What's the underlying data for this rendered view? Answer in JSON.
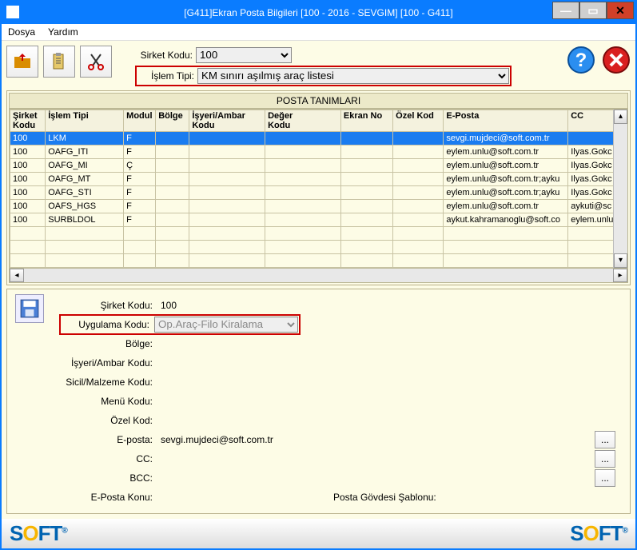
{
  "window": {
    "title": "[G411]Ekran Posta Bilgileri [100 - 2016 - SEVGIM] [100 - G411]"
  },
  "menu": {
    "file": "Dosya",
    "help": "Yardım"
  },
  "filters": {
    "sirket_label": "Sirket Kodu:",
    "sirket_value": "100",
    "islem_label": "İşlem Tipi:",
    "islem_value": "KM sınırı aşılmış araç listesi"
  },
  "grid": {
    "title": "POSTA TANIMLARI",
    "cols": [
      "Şirket Kodu",
      "İşlem Tipi",
      "Modul",
      "Bölge",
      "İşyeri/Ambar Kodu",
      "Değer Kodu",
      "Ekran No",
      "Özel Kod",
      "E-Posta",
      "CC"
    ],
    "rows": [
      {
        "sel": true,
        "c": [
          "100",
          "LKM",
          "F",
          "",
          "",
          "",
          "",
          "",
          "sevgi.mujdeci@soft.com.tr",
          ""
        ]
      },
      {
        "sel": false,
        "c": [
          "100",
          "OAFG_ITI",
          "F",
          "",
          "",
          "",
          "",
          "",
          "eylem.unlu@soft.com.tr",
          "Ilyas.Gokc"
        ]
      },
      {
        "sel": false,
        "c": [
          "100",
          "OAFG_MI",
          "Ç",
          "",
          "",
          "",
          "",
          "",
          "eylem.unlu@soft.com.tr",
          "Ilyas.Gokc"
        ]
      },
      {
        "sel": false,
        "c": [
          "100",
          "OAFG_MT",
          "F",
          "",
          "",
          "",
          "",
          "",
          "eylem.unlu@soft.com.tr;ayku",
          "Ilyas.Gokc"
        ]
      },
      {
        "sel": false,
        "c": [
          "100",
          "OAFG_STI",
          "F",
          "",
          "",
          "",
          "",
          "",
          "eylem.unlu@soft.com.tr;ayku",
          "Ilyas.Gokc"
        ]
      },
      {
        "sel": false,
        "c": [
          "100",
          "OAFS_HGS",
          "F",
          "",
          "",
          "",
          "",
          "",
          "eylem.unlu@soft.com.tr",
          "aykuti@sc"
        ]
      },
      {
        "sel": false,
        "c": [
          "100",
          "SURBLDOL",
          "F",
          "",
          "",
          "",
          "",
          "",
          "aykut.kahramanoglu@soft.co",
          "eylem.unlu"
        ]
      }
    ]
  },
  "form": {
    "sirket_label": "Şirket Kodu:",
    "sirket_val": "100",
    "uyg_label": "Uygulama Kodu:",
    "uyg_val": "Op.Araç-Filo Kiralama",
    "bolge_label": "Bölge:",
    "isyeri_label": "İşyeri/Ambar Kodu:",
    "sicil_label": "Sicil/Malzeme Kodu:",
    "menu_label": "Menü Kodu:",
    "ozel_label": "Özel Kod:",
    "eposta_label": "E-posta:",
    "eposta_val": "sevgi.mujdeci@soft.com.tr",
    "cc_label": "CC:",
    "bcc_label": "BCC:",
    "konu_label": "E-Posta Konu:",
    "sablon_label": "Posta Gövdesi Şablonu:",
    "dots": "..."
  },
  "footer": {
    "brand": "SOFT"
  }
}
